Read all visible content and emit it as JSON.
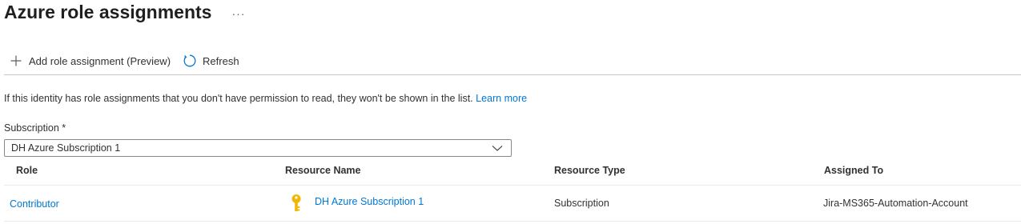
{
  "header": {
    "title": "Azure role assignments",
    "more_label": "···"
  },
  "toolbar": {
    "add_label": "Add role assignment (Preview)",
    "add_icon": "plus-icon",
    "refresh_label": "Refresh",
    "refresh_icon": "refresh-icon"
  },
  "info": {
    "text": "If this identity has role assignments that you don't have permission to read, they won't be shown in the list.",
    "link_label": "Learn more"
  },
  "subscription": {
    "label": "Subscription *",
    "selected": "DH Azure Subscription 1"
  },
  "table": {
    "columns": [
      "Role",
      "Resource Name",
      "Resource Type",
      "Assigned To"
    ],
    "rows": [
      {
        "role": "Contributor",
        "resource_name": "DH Azure Subscription 1",
        "resource_icon": "key-icon",
        "resource_type": "Subscription",
        "assigned_to": "Jira-MS365-Automation-Account"
      }
    ]
  },
  "colors": {
    "link": "#0078d4",
    "key_icon": "#f2b705",
    "border": "#8a8886"
  }
}
